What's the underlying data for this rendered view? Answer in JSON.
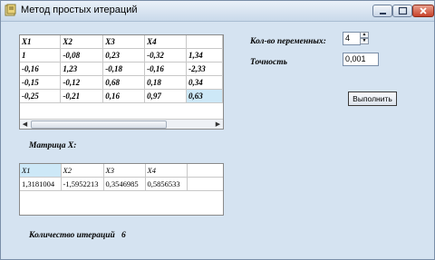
{
  "window": {
    "title": "Метод простых итераций"
  },
  "matrix_grid": {
    "headers": [
      "X1",
      "X2",
      "X3",
      "X4",
      ""
    ],
    "rows": [
      [
        "1",
        "-0,08",
        "0,23",
        "-0,32",
        "1,34"
      ],
      [
        "-0,16",
        "1,23",
        "-0,18",
        "-0,16",
        "-2,33"
      ],
      [
        "-0,15",
        "-0,12",
        "0,68",
        "0,18",
        "0,34"
      ],
      [
        "-0,25",
        "-0,21",
        "0,16",
        "0,97",
        "0,63"
      ]
    ]
  },
  "variables_label": "Кол-во переменных:",
  "variables_value": "4",
  "precision_label": "Точность",
  "precision_value": "0,001",
  "run_button": "Выполнить",
  "result_label": "Матрица X:",
  "result_grid": {
    "headers": [
      "X1",
      "X2",
      "X3",
      "X4"
    ],
    "row": [
      "1,3181004",
      "-1,5952213",
      "0,3546985",
      "0,5856533"
    ]
  },
  "iterations_label": "Количество итераций",
  "iterations_value": "6"
}
